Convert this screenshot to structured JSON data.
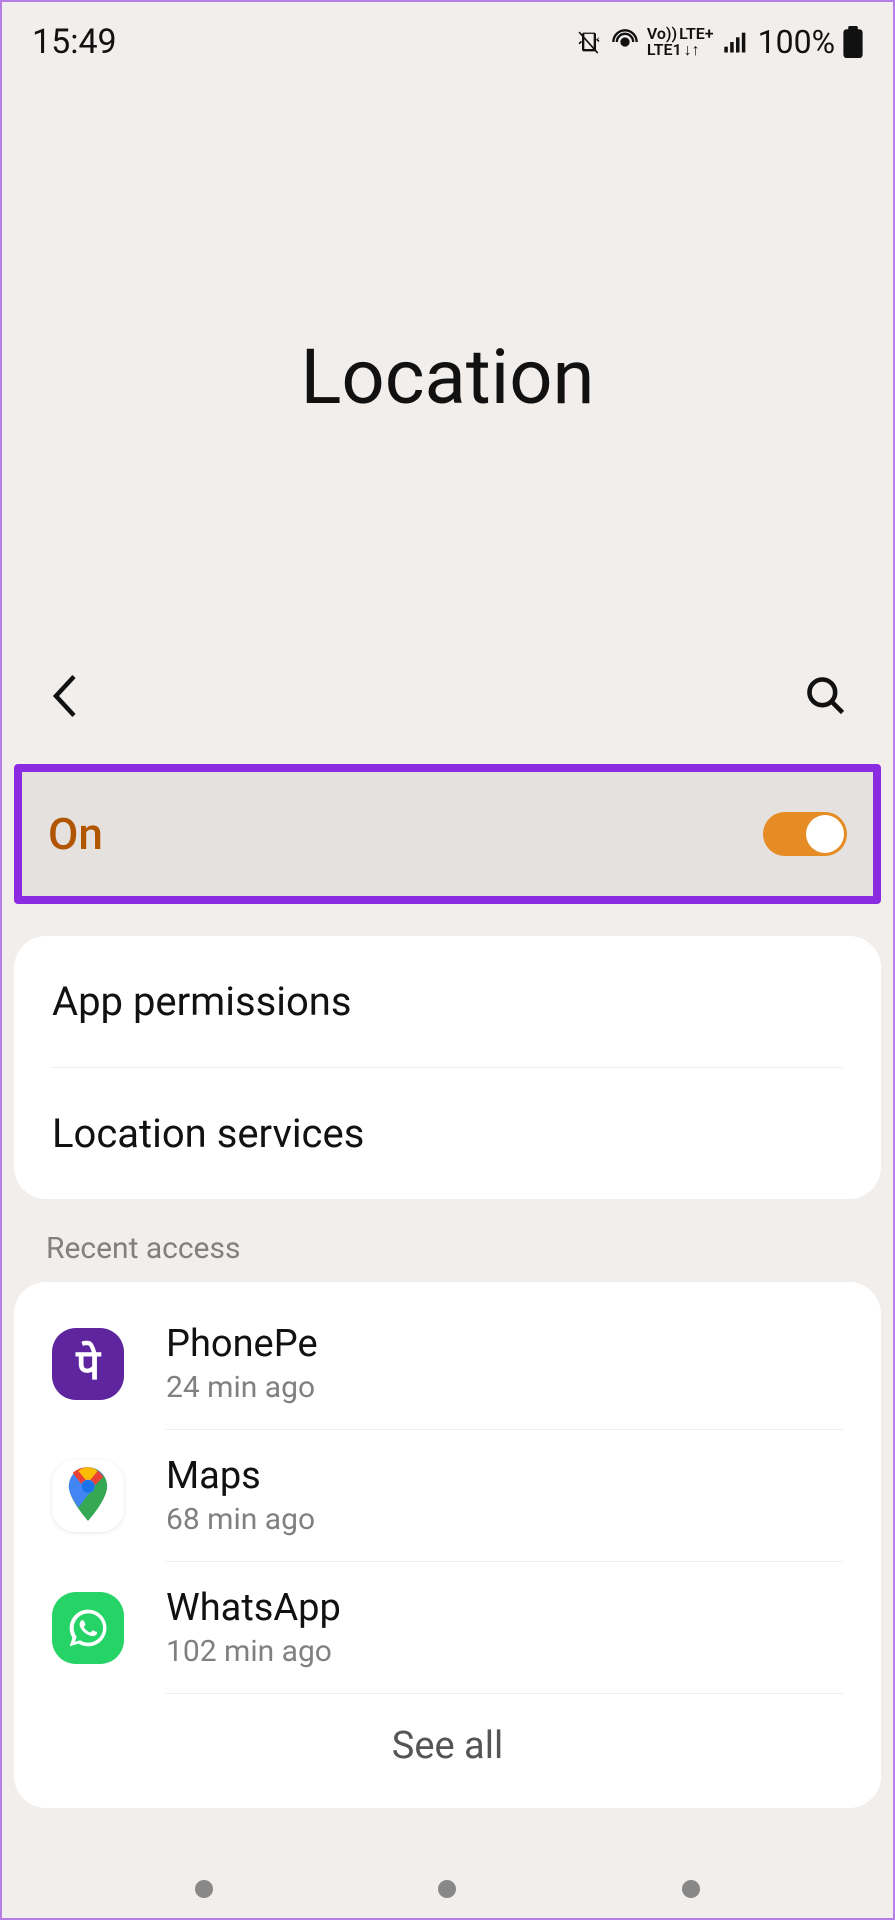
{
  "statusBar": {
    "time": "15:49",
    "batteryPercent": "100%",
    "lteLine1": "Vo))",
    "lteLine2": "LTE1",
    "lteLine3": "LTE+",
    "lteArrows": "↓↑"
  },
  "pageTitle": "Location",
  "toggle": {
    "label": "On",
    "on": true
  },
  "menu": {
    "appPermissions": "App permissions",
    "locationServices": "Location services"
  },
  "recentAccess": {
    "header": "Recent access",
    "apps": [
      {
        "name": "PhonePe",
        "time": "24 min ago",
        "iconText": "पे"
      },
      {
        "name": "Maps",
        "time": "68 min ago"
      },
      {
        "name": "WhatsApp",
        "time": "102 min ago"
      }
    ],
    "seeAll": "See all"
  }
}
